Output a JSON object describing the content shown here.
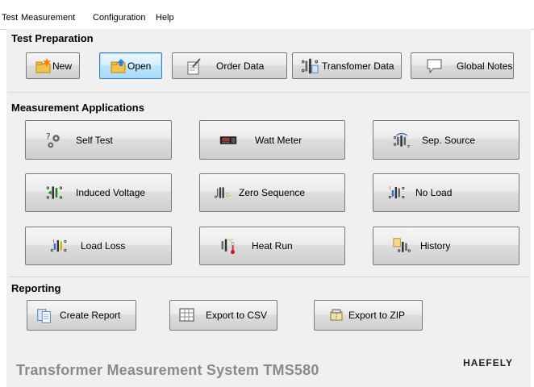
{
  "menu": [
    "Test",
    "Measurement",
    "Configuration",
    "Help"
  ],
  "prep": {
    "title": "Test Preparation",
    "new": "New",
    "open": "Open",
    "order_data": "Order Data",
    "transformer_data": "Transfomer Data",
    "global_notes": "Global Notes"
  },
  "apps": {
    "title": "Measurement Applications",
    "self_test": "Self Test",
    "watt_meter": "Watt Meter",
    "sep_source": "Sep. Source",
    "induced_voltage": "Induced Voltage",
    "zero_sequence": "Zero Sequence",
    "no_load": "No Load",
    "load_loss": "Load Loss",
    "heat_run": "Heat Run",
    "history": "History"
  },
  "reporting": {
    "title": "Reporting",
    "create_report": "Create Report",
    "export_csv": "Export to CSV",
    "export_zip": "Export to ZIP"
  },
  "footer": {
    "system_title": "Transformer Measurement System TMS580",
    "brand": "HAEFELY"
  },
  "icons": {
    "new": "new-file-icon",
    "open": "open-folder-icon",
    "order_data": "document-pencil-icon",
    "transformer_data": "transformer-document-icon",
    "global_notes": "speech-bubble-icon",
    "self_test": "gears-question-icon",
    "watt_meter": "meter-device-icon",
    "sep_source": "transformer-source-icon",
    "induced_voltage": "transformer-arrow-icon",
    "zero_sequence": "transformer-zero-icon",
    "no_load": "transformer-noload-icon",
    "load_loss": "transformer-loadloss-icon",
    "heat_run": "transformer-thermometer-icon",
    "history": "transformer-history-icon",
    "create_report": "report-icon",
    "export_csv": "table-grid-icon",
    "export_zip": "zip-archive-icon"
  }
}
